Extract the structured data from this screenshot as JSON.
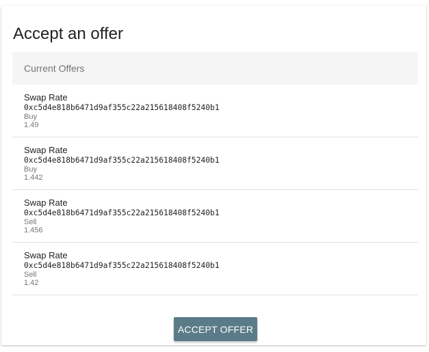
{
  "card": {
    "title": "Accept an offer"
  },
  "offers_list": {
    "header": "Current Offers",
    "items": [
      {
        "title": "Swap Rate",
        "address": "0xc5d4e818b6471d9af355c22a215618408f5240b1",
        "side": "Buy",
        "rate": "1.49"
      },
      {
        "title": "Swap Rate",
        "address": "0xc5d4e818b6471d9af355c22a215618408f5240b1",
        "side": "Buy",
        "rate": "1.442"
      },
      {
        "title": "Swap Rate",
        "address": "0xc5d4e818b6471d9af355c22a215618408f5240b1",
        "side": "Sell",
        "rate": "1.456"
      },
      {
        "title": "Swap Rate",
        "address": "0xc5d4e818b6471d9af355c22a215618408f5240b1",
        "side": "Sell",
        "rate": "1.42"
      }
    ]
  },
  "actions": {
    "accept_label": "ACCEPT OFFER"
  },
  "colors": {
    "button_background": "#5b7b88",
    "header_background": "#f5f5f5",
    "secondary_text": "#757575"
  }
}
